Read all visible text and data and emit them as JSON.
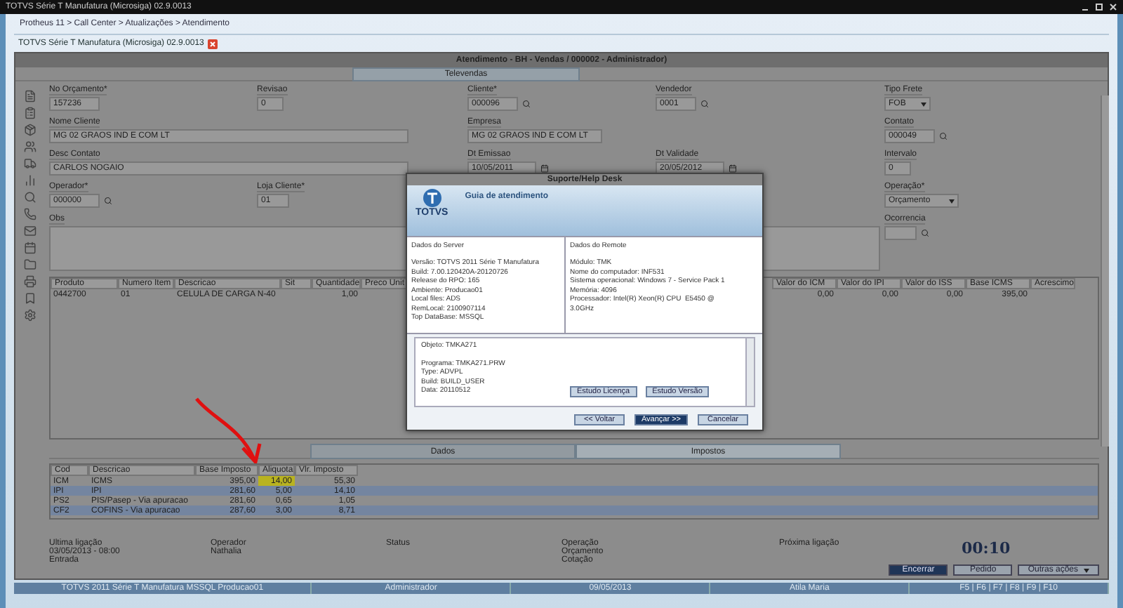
{
  "os_window": {
    "title": "TOTVS Série T Manufatura (Microsiga) 02.9.0013"
  },
  "breadcrumb": "Protheus 11 > Call Center > Atualizações > Atendimento",
  "app_tab": {
    "label": "TOTVS Série T Manufatura (Microsiga) 02.9.0013"
  },
  "inner_window": {
    "title": "Atendimento - BH - Vendas / 000002 - Administrador)",
    "tab": "Televendas"
  },
  "form": {
    "rows": [
      [
        {
          "label": "No Orçamento*",
          "value": "157236",
          "kind": "text"
        },
        {
          "label": "Revisao",
          "value": "0",
          "kind": "text"
        },
        {
          "label": "Cliente*",
          "value": "000096",
          "kind": "lookup"
        },
        {
          "label": "Vendedor",
          "value": "0001",
          "kind": "lookup"
        },
        {
          "label": "Tipo Frete",
          "value": "FOB",
          "kind": "select"
        }
      ],
      [
        {
          "label": "Nome Cliente",
          "value": "MG 02 GRAOS IND E COM LT",
          "kind": "text",
          "wide": true
        },
        "",
        {
          "label": "Empresa",
          "value": "MG 02 GRAOS IND E COM LT",
          "kind": "text"
        },
        "",
        {
          "label": "Contato",
          "value": "000049",
          "kind": "lookup"
        }
      ],
      [
        {
          "label": "Desc Contato",
          "value": "CARLOS NOGAIO",
          "kind": "text",
          "wide": true
        },
        "",
        {
          "label": "Dt Emissao",
          "value": "10/05/2011",
          "kind": "date"
        },
        {
          "label": "Dt Validade",
          "value": "20/05/2012",
          "kind": "date"
        },
        {
          "label": "Intervalo",
          "value": "0",
          "kind": "text"
        }
      ],
      [
        {
          "label": "Operador*",
          "value": "000000",
          "kind": "lookup"
        },
        {
          "label": "Loja Cliente*",
          "value": "01",
          "kind": "text"
        },
        "",
        "",
        {
          "label": "Operação*",
          "value": "Orçamento",
          "kind": "select"
        }
      ],
      [
        {
          "label": "Obs",
          "kind": "textarea"
        },
        "",
        "",
        "",
        {
          "label": "Ocorrencia",
          "kind": "lookup"
        }
      ]
    ]
  },
  "items_table": {
    "columns": [
      "Produto",
      "Numero Item",
      "Descricao",
      "Sit",
      "Quantidade",
      "Preco Unit",
      "Valor do ICM",
      "Valor do IPI",
      "Valor do ISS",
      "Base ICMS",
      "Acrescimo"
    ],
    "rows": [
      [
        "0442700",
        "01",
        "CELULA DE CARGA N-40",
        null,
        "1,00",
        null,
        "0,00",
        "0,00",
        "0,00",
        "395,00",
        null
      ]
    ]
  },
  "lower_tabs": [
    {
      "label": "Dados",
      "selected": false
    },
    {
      "label": "Impostos",
      "selected": true
    }
  ],
  "tax_table": {
    "columns": [
      "Cod",
      "Descricao",
      "Base Imposto",
      "Aliquota",
      "Vlr. Imposto"
    ],
    "rows": [
      {
        "cells": [
          "ICM",
          "ICMS",
          "395,00",
          {
            "text": "14,00",
            "highlighted": true
          },
          "55,30"
        ],
        "striped": false
      },
      {
        "cells": [
          "IPI",
          "IPI",
          "281,60",
          "5,00",
          "14,10"
        ],
        "striped": true
      },
      {
        "cells": [
          "PS2",
          "PIS/Pasep - Via apuracao",
          "281,60",
          "0,65",
          "1,05"
        ],
        "striped": false
      },
      {
        "cells": [
          "CF2",
          "COFINS - Via apuracao",
          "287,60",
          "3,00",
          "8,71"
        ],
        "striped": true
      }
    ]
  },
  "info": {
    "last_call_label": "Ultima ligação",
    "last_call_date": "03/05/2013 - 08:00",
    "last_call_type": "Entrada",
    "operator_label": "Operador",
    "operator": "Nathalia",
    "status_label": "Status",
    "operation_label": "Operação",
    "operation_lines": [
      "Orçamento",
      "Cotação"
    ],
    "next_call_label": "Próxima ligação",
    "timer": "00:10"
  },
  "action_buttons": [
    {
      "label": "Encerrar",
      "primary": true
    },
    {
      "label": "Pedido",
      "primary": false
    },
    {
      "label": "Outras ações",
      "primary": false,
      "dropdown": true
    }
  ],
  "status_bar": [
    "TOTVS 2011 Série T Manufatura MSSQL Producao01",
    "Administrador",
    "09/05/2013",
    "Atila Maria",
    "F5 | F6 | F7 | F8 | F9 | F10"
  ],
  "dialog": {
    "title": "Suporte/Help Desk",
    "heading": "Guia de atendimento",
    "logo_text": "TOTVS",
    "server": {
      "title": "Dados do Server",
      "lines": [
        "Versão: TOTVS 2011 Série T Manufatura",
        "Build: 7.00.120420A-20120726",
        "Release do RPO: 165",
        "Ambiente: Producao01",
        "Local files: ADS",
        "RemLocal: 2100907114",
        "Top DataBase: MSSQL"
      ]
    },
    "remote": {
      "title": "Dados do Remote",
      "lines": [
        "Módulo: TMK",
        "Nome do computador: INF531",
        "Sistema operacional: Windows 7 - Service Pack 1",
        "Memória: 4096",
        "Processador: Intel(R) Xeon(R) CPU  E5450 @",
        "3.0GHz"
      ]
    },
    "object_lines": [
      "Objeto: TMKA271",
      "Programa: TMKA271.PRW",
      "Type: ADVPL",
      "Build: BUILD_USER",
      "Data: 20110512"
    ],
    "inner_buttons": [
      "Estudo Licença",
      "Estudo Versão"
    ],
    "footer_buttons": [
      {
        "label": "<< Voltar",
        "primary": false
      },
      {
        "label": "Avançar >>",
        "primary": true
      },
      {
        "label": "Cancelar",
        "primary": false
      }
    ]
  }
}
